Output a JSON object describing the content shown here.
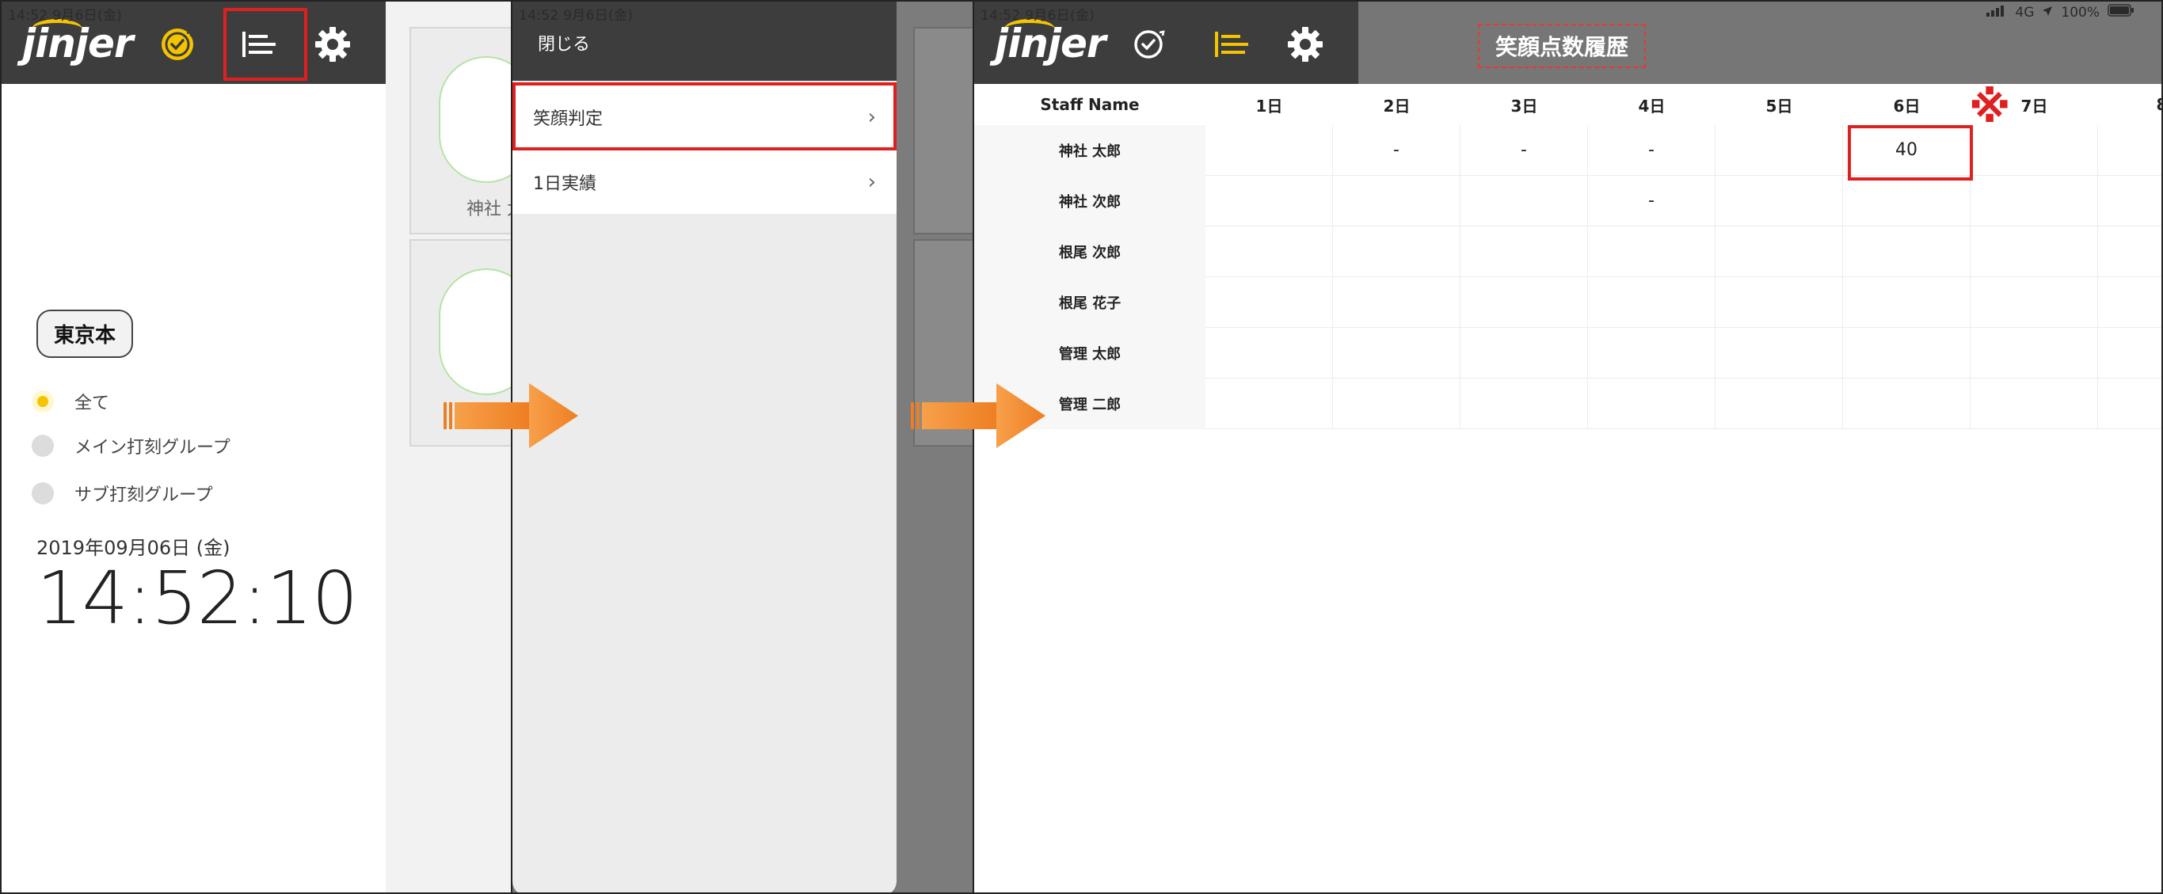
{
  "status": {
    "time_date_p1": "14:52 9月6日(金)",
    "time_date_p2": "14:52 9月6日(金)",
    "time_date_p3": "14:52 9月6日(金)",
    "network": "4G",
    "battery": "100%"
  },
  "brand": {
    "logo_text": "jinjer",
    "accent_color": "#f5c400",
    "highlight_color": "#e02020",
    "arrow_color": "#f08a2e"
  },
  "panel1": {
    "header_icons": [
      "clock-check-icon",
      "menu-list-icon",
      "gear-icon"
    ],
    "location_badge": "東京本",
    "filters": [
      {
        "label": "全て",
        "selected": true
      },
      {
        "label": "メイン打刻グループ",
        "selected": false
      },
      {
        "label": "サブ打刻グループ",
        "selected": false
      }
    ],
    "date": "2019年09月06日 (金)",
    "time": "14:52:10",
    "staff_cards": [
      {
        "name": "神社 太"
      },
      {
        "name": ""
      }
    ]
  },
  "panel2": {
    "close_label": "閉じる",
    "menu": [
      {
        "label": "笑顔判定"
      },
      {
        "label": "1日実績"
      }
    ]
  },
  "panel3": {
    "page_title": "笑顔点数履歴",
    "header_icons": [
      "clock-check-icon",
      "menu-list-icon",
      "gear-icon"
    ],
    "table": {
      "name_header": "Staff Name",
      "days": [
        "1日",
        "2日",
        "3日",
        "4日",
        "5日",
        "6日",
        "7日",
        "8"
      ],
      "rows": [
        {
          "name": "神社 太郎",
          "values": [
            "",
            "-",
            "-",
            "-",
            "",
            "40",
            "",
            ""
          ]
        },
        {
          "name": "神社 次郎",
          "values": [
            "",
            "",
            "",
            "-",
            "",
            "",
            "",
            ""
          ]
        },
        {
          "name": "根尾 次郎",
          "values": [
            "",
            "",
            "",
            "",
            "",
            "",
            "",
            ""
          ]
        },
        {
          "name": "根尾 花子",
          "values": [
            "",
            "",
            "",
            "",
            "",
            "",
            "",
            ""
          ]
        },
        {
          "name": "管理 太郎",
          "values": [
            "",
            "",
            "",
            "",
            "",
            "",
            "",
            ""
          ]
        },
        {
          "name": "管理 二郎",
          "values": [
            "",
            "",
            "",
            "",
            "",
            "",
            "",
            ""
          ]
        }
      ]
    },
    "note_mark": "※"
  }
}
